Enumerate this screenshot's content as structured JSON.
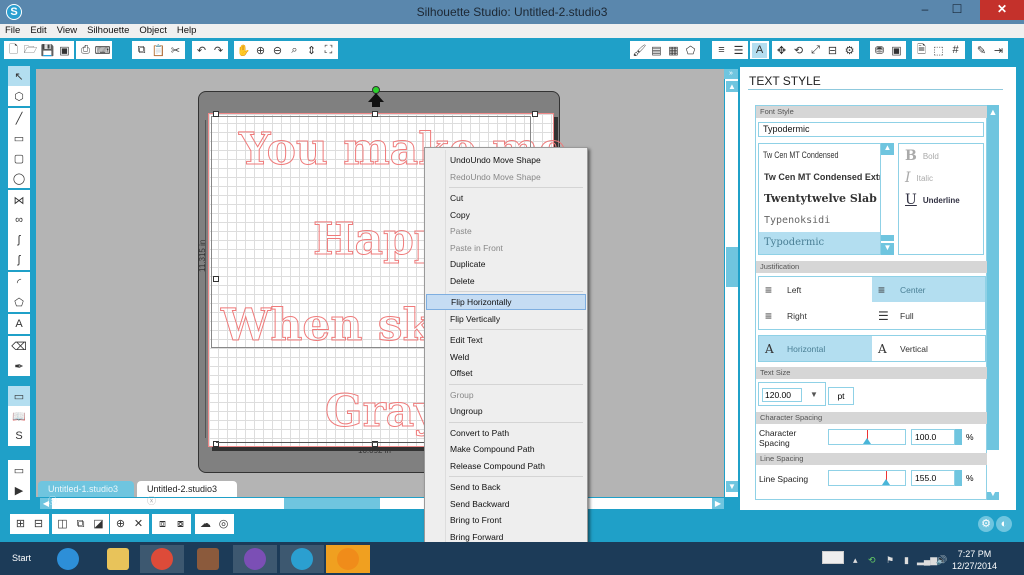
{
  "window": {
    "title": "Silhouette Studio: Untitled-2.studio3",
    "minimize": "–",
    "maximize": "☐",
    "close": "✕"
  },
  "menu": [
    "File",
    "Edit",
    "View",
    "Silhouette",
    "Object",
    "Help"
  ],
  "toolbar_left": [
    [
      "new-doc-icon",
      "new-page-icon",
      "🗋"
    ],
    [
      "open-icon",
      "open-icon",
      "🗁"
    ],
    [
      "save-icon",
      "save-icon",
      "💾"
    ],
    [
      "save-library-icon",
      "save-to-library-icon",
      "▣"
    ],
    [
      "print-icon",
      "print-icon",
      "⎙"
    ],
    [
      "print-cut-icon",
      "send-to-silhouette-icon",
      "⌨"
    ],
    [
      "copy-icon",
      "copy-icon",
      "⧉"
    ],
    [
      "paste-icon",
      "paste-icon",
      "📋"
    ],
    [
      "cut-icon",
      "cut-icon",
      "✂"
    ],
    [
      "undo-icon",
      "undo-icon",
      "↶"
    ],
    [
      "redo-icon",
      "redo-icon",
      "↷"
    ],
    [
      "pan-icon",
      "pan-icon",
      "✋"
    ],
    [
      "zoom-in-icon",
      "zoom-in-icon",
      "⊕"
    ],
    [
      "zoom-out-icon",
      "zoom-out-icon",
      "⊖"
    ],
    [
      "zoom-select-icon",
      "zoom-select-icon",
      "⌕"
    ],
    [
      "drag-zoom-icon",
      "drag-zoom-icon",
      "⇕"
    ],
    [
      "fit-page-icon",
      "fit-to-page-icon",
      "⛶"
    ]
  ],
  "toolbar_right": [
    [
      "fill-color-icon",
      "🖌"
    ],
    [
      "gradient-icon",
      "▤"
    ],
    [
      "pattern-icon",
      "▦"
    ],
    [
      "line-style-icon",
      "⬠"
    ],
    [
      "line-color-icon",
      "≡"
    ],
    [
      "line-width-icon",
      "☰"
    ],
    [
      "text-style-icon",
      "A"
    ],
    [
      "move-icon",
      "✥"
    ],
    [
      "rotate-icon",
      "⟲"
    ],
    [
      "scale-icon",
      "⤢"
    ],
    [
      "align-icon",
      "⊟"
    ],
    [
      "replicate-icon",
      "⚙"
    ],
    [
      "library-icon",
      "⛃"
    ],
    [
      "trace-icon",
      "▣"
    ],
    [
      "page-setup-icon",
      "🗎"
    ],
    [
      "cut-settings-icon",
      "⬚"
    ],
    [
      "grid-icon",
      "#"
    ],
    [
      "eraser-icon",
      "✎"
    ],
    [
      "send-icon",
      "⇥"
    ]
  ],
  "left_tools": [
    [
      "select-tool",
      "↖"
    ],
    [
      "point-edit-tool",
      "⬡"
    ],
    [
      "line-tool",
      "╱"
    ],
    [
      "rectangle-tool",
      "▭"
    ],
    [
      "rounded-rect-tool",
      "▢"
    ],
    [
      "ellipse-tool",
      "◯"
    ],
    [
      "polygon-tool",
      "⋈"
    ],
    [
      "curve-tool",
      "∞"
    ],
    [
      "freehand-tool",
      "ʃ"
    ],
    [
      "smooth-freehand-tool",
      "ʃ"
    ],
    [
      "arc-tool",
      "◜"
    ],
    [
      "regular-polygon-tool",
      "⬠"
    ],
    [
      "text-tool",
      "A"
    ],
    [
      "eraser-tool",
      "⌫"
    ],
    [
      "knife-tool",
      "✒"
    ],
    [
      "design-page-tool",
      "▭"
    ],
    [
      "library-tool",
      "📖"
    ],
    [
      "store-tool",
      "S"
    ],
    [
      "panel-tool",
      "▭"
    ],
    [
      "play-tool",
      "▶"
    ]
  ],
  "canvas": {
    "lines": [
      "You make me",
      "Happy",
      "When skie",
      "Gray."
    ],
    "height_dim": "11.315 in",
    "width_dim": "10.092 in"
  },
  "tabs": [
    {
      "label": "Untitled-1.studio3",
      "active": false
    },
    {
      "label": "Untitled-2.studio3",
      "active": true
    }
  ],
  "bottom_tools": [
    [
      "group-icon",
      "⊞"
    ],
    [
      "ungroup-icon",
      "⊟"
    ],
    [
      "compound-icon",
      "◫"
    ],
    [
      "release-compound-icon",
      "⧉"
    ],
    [
      "offset-shape-icon",
      "◪"
    ],
    [
      "weld-icon",
      "⊕"
    ],
    [
      "delete-icon",
      "✕"
    ],
    [
      "bring-forward-icon",
      "⧈"
    ],
    [
      "send-backward-icon",
      "⧇"
    ],
    [
      "shape-icon",
      "☁"
    ],
    [
      "offset-icon",
      "◎"
    ]
  ],
  "context_menu": [
    {
      "label": "UndoUndo Move Shape",
      "disabled": false
    },
    {
      "label": "RedoUndo Move Shape",
      "disabled": true
    },
    {
      "sep": true
    },
    {
      "label": "Cut",
      "disabled": false
    },
    {
      "label": "Copy",
      "disabled": false
    },
    {
      "label": "Paste",
      "disabled": true
    },
    {
      "label": "Paste in Front",
      "disabled": true
    },
    {
      "label": "Duplicate",
      "disabled": false
    },
    {
      "label": "Delete",
      "disabled": false
    },
    {
      "sep": true
    },
    {
      "label": "Flip Horizontally",
      "disabled": false,
      "highlighted": true
    },
    {
      "label": "Flip Vertically",
      "disabled": false
    },
    {
      "sep": true
    },
    {
      "label": "Edit Text",
      "disabled": false
    },
    {
      "label": "Weld",
      "disabled": false
    },
    {
      "label": "Offset",
      "disabled": false
    },
    {
      "sep": true
    },
    {
      "label": "Group",
      "disabled": true
    },
    {
      "label": "Ungroup",
      "disabled": false
    },
    {
      "sep": true
    },
    {
      "label": "Convert to Path",
      "disabled": false
    },
    {
      "label": "Make Compound Path",
      "disabled": false
    },
    {
      "label": "Release Compound Path",
      "disabled": false
    },
    {
      "sep": true
    },
    {
      "label": "Send to Back",
      "disabled": false
    },
    {
      "label": "Send Backward",
      "disabled": false
    },
    {
      "label": "Bring to Front",
      "disabled": false
    },
    {
      "label": "Bring Forward",
      "disabled": false
    }
  ],
  "panel": {
    "title": "TEXT STYLE",
    "font_style_label": "Font Style",
    "font_value": "Typodermic",
    "fonts": [
      "Tw Cen MT Condensed",
      "Tw Cen MT Condensed Extra",
      "Twentytwelve Slab",
      "Typenoksidi",
      "Typodermic"
    ],
    "selected_font": "Typodermic",
    "styles": [
      {
        "glyph": "B",
        "label": "Bold",
        "enabled": false
      },
      {
        "glyph": "I",
        "label": "Italic",
        "enabled": false
      },
      {
        "glyph": "U",
        "label": "Underline",
        "enabled": true
      }
    ],
    "justification_label": "Justification",
    "justify": [
      {
        "label": "Left",
        "glyph": "≡",
        "selected": false
      },
      {
        "label": "Center",
        "glyph": "≡",
        "selected": true
      },
      {
        "label": "Right",
        "glyph": "≡",
        "selected": false
      },
      {
        "label": "Full",
        "glyph": "☰",
        "selected": false
      }
    ],
    "direction": [
      {
        "label": "Horizontal",
        "glyph": "A",
        "selected": true
      },
      {
        "label": "Vertical",
        "glyph": "A",
        "selected": false
      }
    ],
    "text_size_label": "Text Size",
    "text_size": "120.00",
    "text_size_unit": "pt",
    "char_spacing_section": "Character Spacing",
    "char_spacing_label": "Character Spacing",
    "char_spacing": "100.0",
    "char_spacing_slider": 0.5,
    "line_spacing_section": "Line Spacing",
    "line_spacing_label": "Line Spacing",
    "line_spacing": "155.0",
    "line_spacing_slider": 0.75,
    "pct": "%"
  },
  "taskbar": {
    "start": "Start",
    "apps": [
      "internet-explorer",
      "file-explorer",
      "chrome",
      "avatar-app",
      "picasa",
      "silhouette-studio",
      "avast"
    ],
    "time": "7:27 PM",
    "date": "12/27/2014"
  }
}
